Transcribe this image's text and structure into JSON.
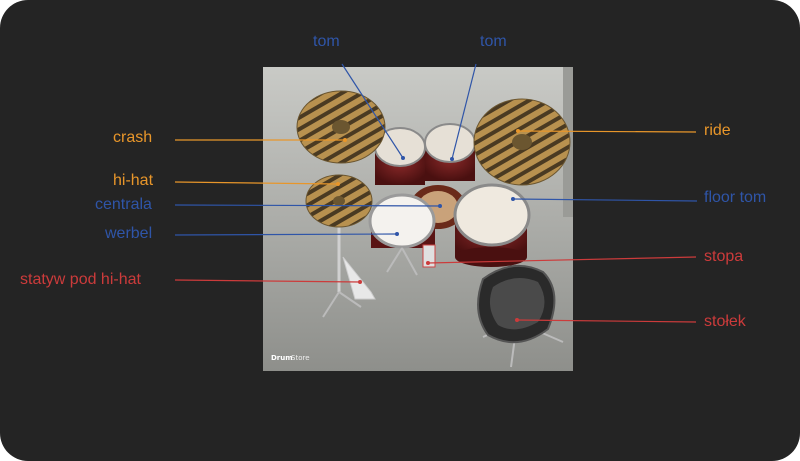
{
  "colors": {
    "background": "#242424",
    "orange": "#e8962a",
    "blue": "#2f55a8",
    "red": "#cc3b3b"
  },
  "photo": {
    "watermark_bold": "Drum",
    "watermark_rest": "Store"
  },
  "labels": {
    "tom_left": "tom",
    "tom_right": "tom",
    "crash": "crash",
    "hihat": "hi-hat",
    "centrala": "centrala",
    "werbel": "werbel",
    "statyw": "statyw pod hi-hat",
    "ride": "ride",
    "floor_tom": "floor tom",
    "stopa": "stopa",
    "stolek": "stołek"
  }
}
